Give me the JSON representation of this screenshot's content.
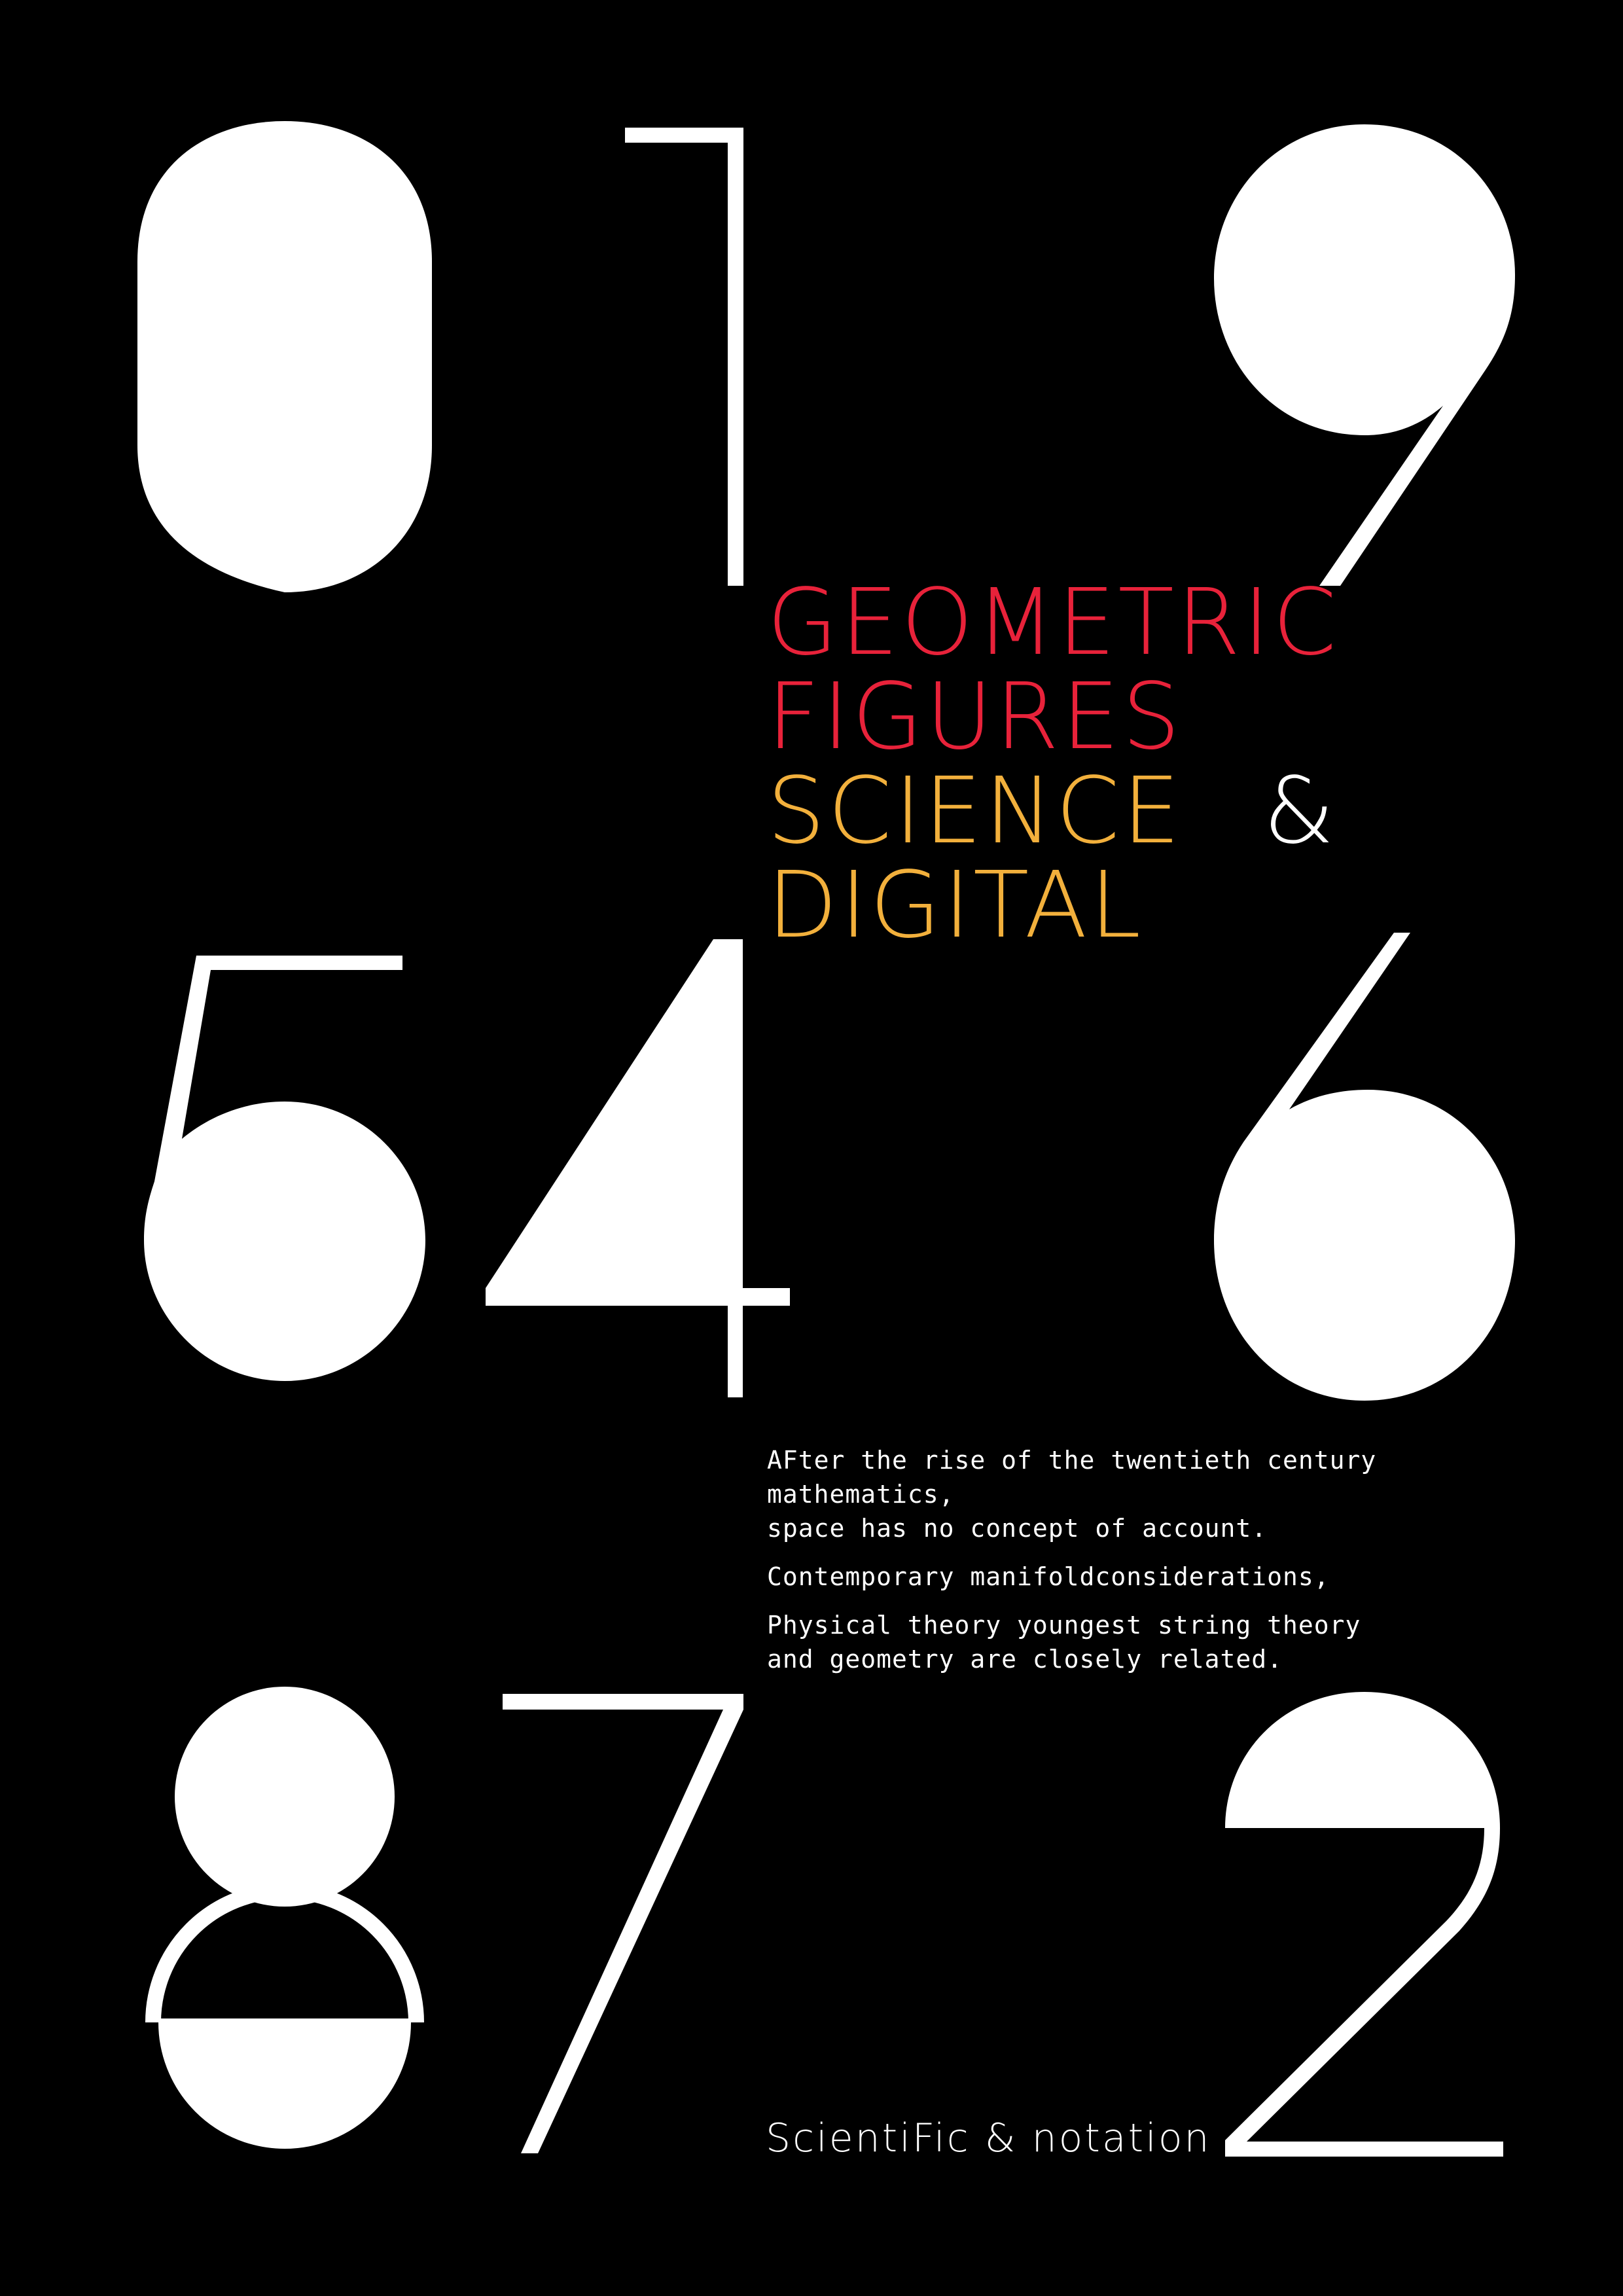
{
  "poster": {
    "headline": {
      "line1": "GEOMETRIC",
      "line2": "FIGURES",
      "line3": "SCIENCE",
      "ampersand": "&",
      "line4": "DIGITAL"
    },
    "body": {
      "paragraph1_line1": "AFter the rise of the twentieth century mathematics,",
      "paragraph1_line2": "space has no concept of account.",
      "paragraph2": "Contemporary manifoldconsiderations,",
      "paragraph3_line1": "Physical theory youngest string theory",
      "paragraph3_line2": "and geometry are closely related."
    },
    "footer": "ScientiFic & notation",
    "digits": [
      "0",
      "1",
      "9",
      "5",
      "4",
      "6",
      "8",
      "7",
      "2"
    ],
    "colors": {
      "background": "#000000",
      "digits": "#ffffff",
      "accent_red": "#e8223a",
      "accent_yellow": "#f2b03c",
      "text": "#ffffff"
    }
  }
}
